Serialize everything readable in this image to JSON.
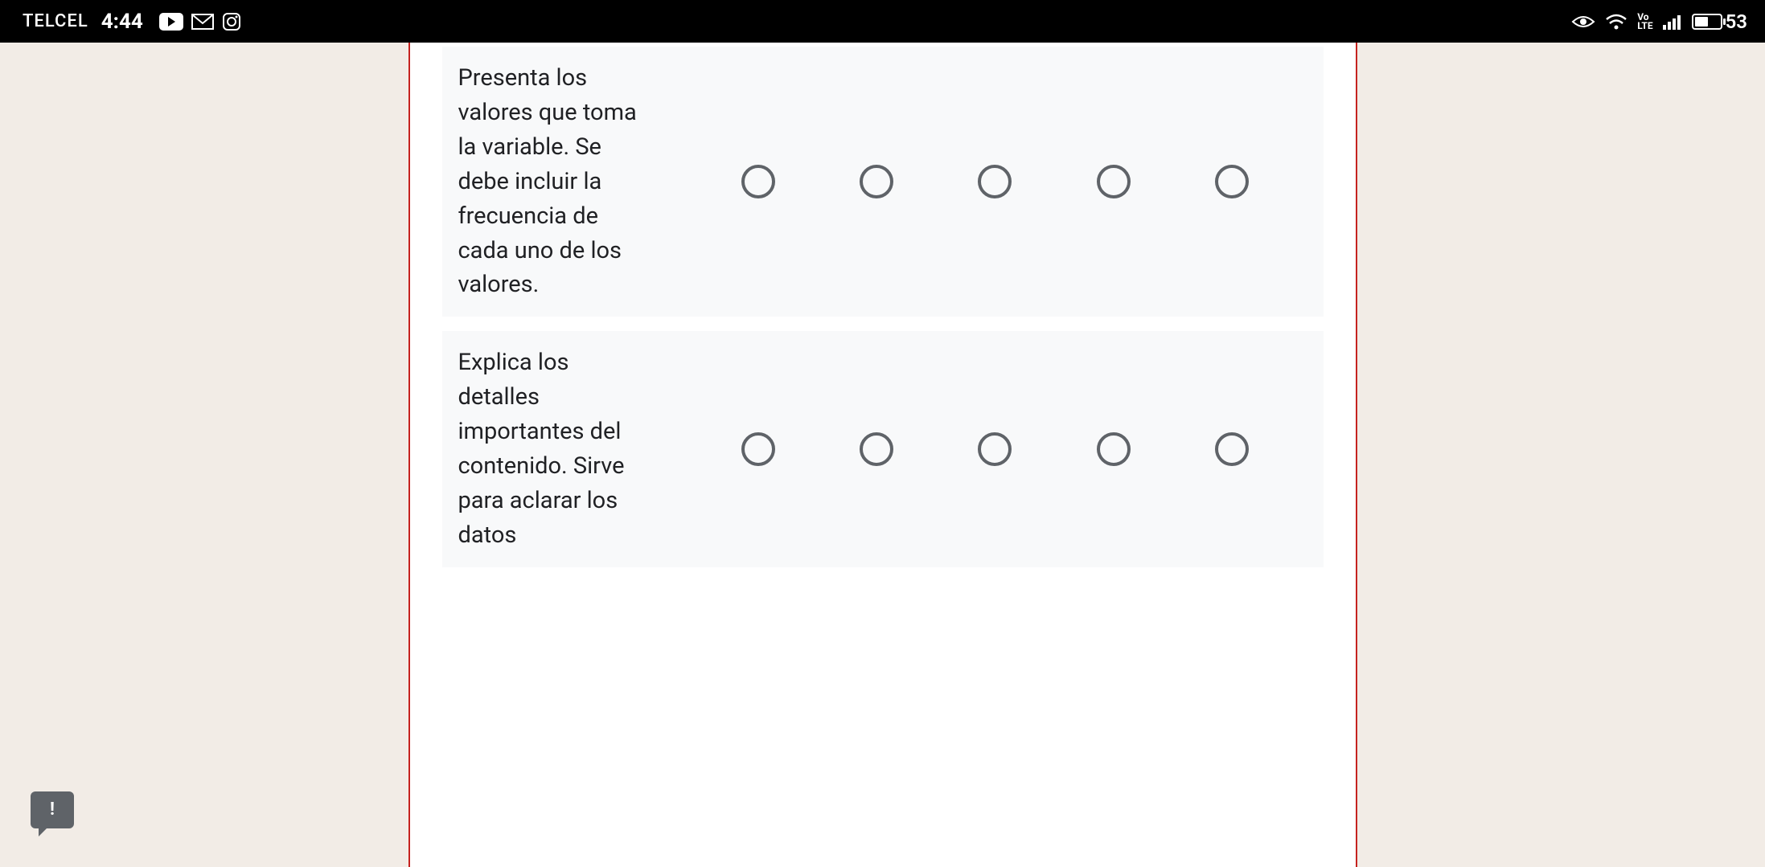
{
  "status_bar": {
    "carrier": "TELCEL",
    "time": "4:44",
    "volte_top": "Vo",
    "volte_bottom": "LTE",
    "battery_percent": "53"
  },
  "form": {
    "rows": [
      {
        "label": "Presenta los valores que toma la variable. Se debe incluir la frecuencia de cada uno de los valores.",
        "options": 5
      },
      {
        "label": "Explica los detalles importantes del contenido. Sirve para aclarar los datos",
        "options": 5
      }
    ]
  },
  "feedback_glyph": "!"
}
